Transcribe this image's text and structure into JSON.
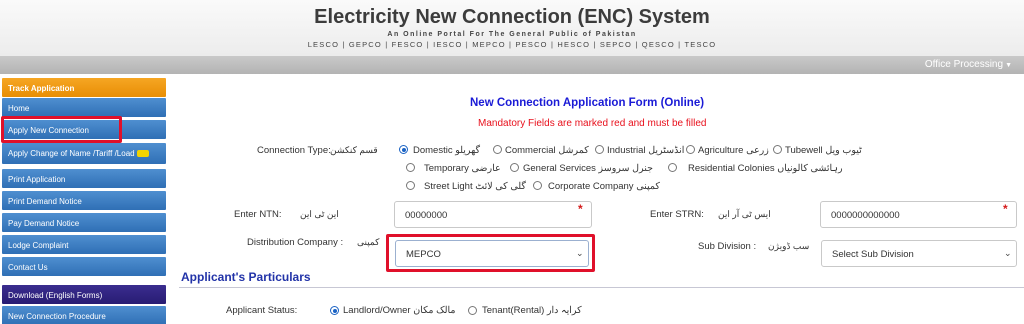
{
  "header": {
    "title": "Electricity New Connection (ENC) System",
    "subtitle": "An Online Portal For The General Public of Pakistan",
    "companies": "LESCO | GEPCO | FESCO | IESCO | MEPCO | PESCO | HESCO | SEPCO | QESCO | TESCO",
    "office_menu": "Office Processing"
  },
  "sidebar": {
    "items": [
      {
        "label": "Track Application"
      },
      {
        "label": "Home"
      },
      {
        "label": "Apply New Connection"
      },
      {
        "label": "Apply Change of Name /Tariff /Load"
      },
      {
        "label": "Print Application"
      },
      {
        "label": "Print Demand Notice"
      },
      {
        "label": "Pay Demand Notice"
      },
      {
        "label": "Lodge Complaint"
      },
      {
        "label": "Contact Us"
      },
      {
        "label": "Download (English Forms)"
      },
      {
        "label": "New Connection Procedure"
      }
    ]
  },
  "form": {
    "title": "New Connection Application Form (Online)",
    "mandatory_note": "Mandatory Fields are marked red and must be filled",
    "connection_type": {
      "label": "Connection Type:",
      "label_urdu": "قسم کنکشن",
      "options": [
        {
          "en": "Domestic",
          "ur": "گھریلو",
          "selected": true
        },
        {
          "en": "Commercial",
          "ur": "کمرشل",
          "selected": false
        },
        {
          "en": "Industrial",
          "ur": "انڈسٹریل",
          "selected": false
        },
        {
          "en": "Agriculture",
          "ur": "زرعی",
          "selected": false
        },
        {
          "en": "Tubewell",
          "ur": "ٹیوب ویل",
          "selected": false
        },
        {
          "en": "Temporary",
          "ur": "عارضی",
          "selected": false
        },
        {
          "en": "General Services",
          "ur": "جنرل سروسز",
          "selected": false
        },
        {
          "en": "Residential Colonies",
          "ur": "رہائشی کالونیاں",
          "selected": false
        },
        {
          "en": "Street Light",
          "ur": "گلی کی لائٹ",
          "selected": false
        },
        {
          "en": "Corporate Company",
          "ur": "کمپنی",
          "selected": false
        }
      ]
    },
    "ntn": {
      "label": "Enter NTN:",
      "label_urdu": "این ٹی این",
      "value": "00000000"
    },
    "strn": {
      "label": "Enter STRN:",
      "label_urdu": "ایس ٹی آر این",
      "value": "0000000000000"
    },
    "distribution": {
      "label": "Distribution Company :",
      "label_urdu": "کمپنی",
      "value": "MEPCO"
    },
    "subdivision": {
      "label": "Sub Division :",
      "label_urdu": "سب ڈویژن",
      "value": "Select Sub Division"
    },
    "section_title": "Applicant's Particulars",
    "applicant_status": {
      "label": "Applicant Status:",
      "options": [
        {
          "en": "Landlord/Owner",
          "ur": "مالک مکان",
          "selected": true
        },
        {
          "en": "Tenant(Rental)",
          "ur": "کرایہ دار",
          "selected": false
        }
      ]
    }
  },
  "colors": {
    "accent_blue": "#2f6fb5",
    "highlight_red": "#e0102a",
    "title_blue": "#1a1ad6"
  }
}
